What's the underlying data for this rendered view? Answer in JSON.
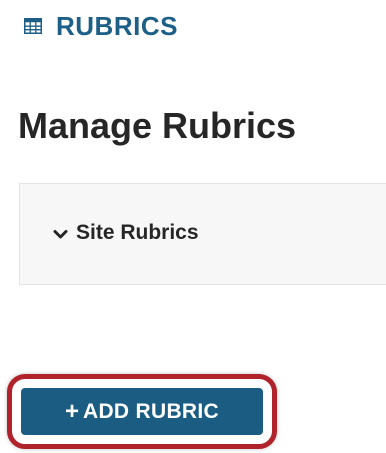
{
  "header": {
    "icon": "table-grid-icon",
    "title": "RUBRICS",
    "accent_color": "#1d5f86"
  },
  "page": {
    "title": "Manage Rubrics"
  },
  "sections": [
    {
      "label": "Site Rubrics",
      "icon": "chevron-down-icon",
      "expanded": false
    }
  ],
  "actions": {
    "add_button": {
      "icon": "plus-icon",
      "plus": "+",
      "label": "ADD RUBRIC",
      "background": "#1b5d82",
      "highlight_color": "#b1232b"
    }
  }
}
